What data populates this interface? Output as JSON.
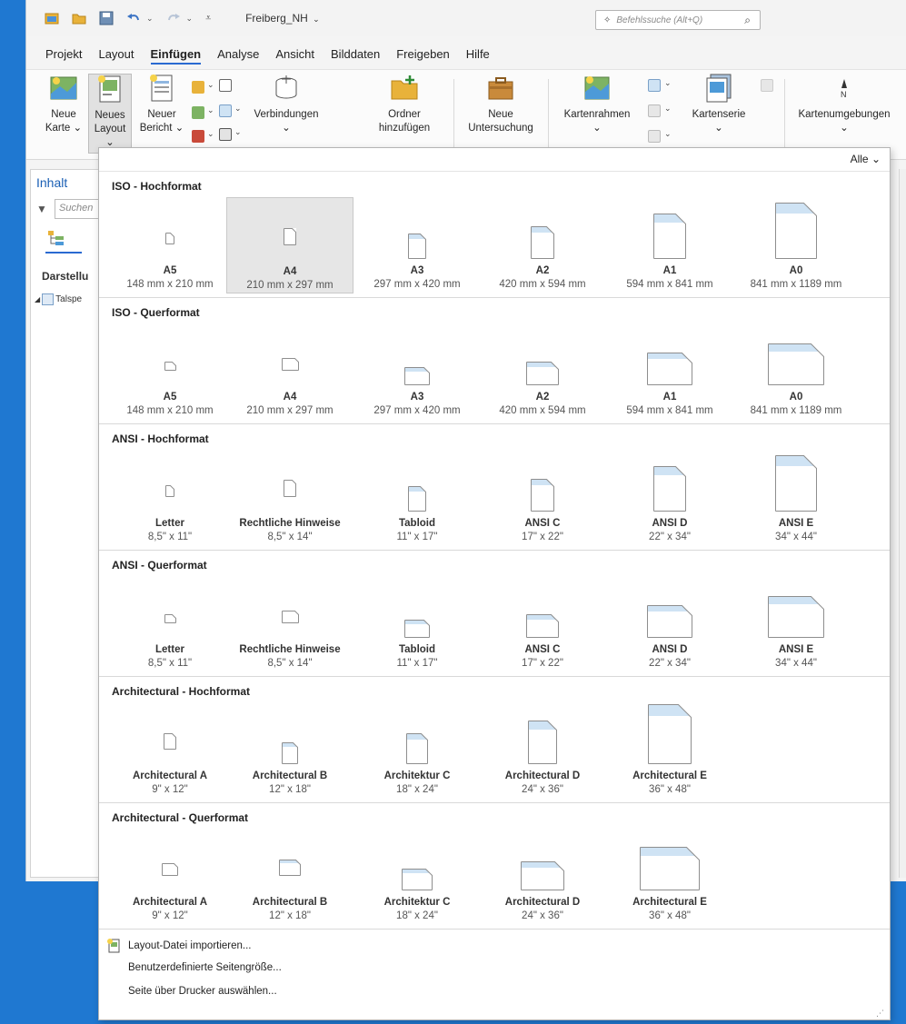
{
  "window": {
    "doc_title": "Freiberg_NH",
    "command_search_placeholder": "Befehlssuche (Alt+Q)"
  },
  "menu": [
    "Projekt",
    "Layout",
    "Einfügen",
    "Analyse",
    "Ansicht",
    "Bilddaten",
    "Freigeben",
    "Hilfe"
  ],
  "menu_active_index": 2,
  "ribbon": {
    "new_map": [
      "Neue",
      "Karte ⌄"
    ],
    "new_layout": [
      "Neues",
      "Layout ⌄"
    ],
    "new_report": [
      "Neuer",
      "Bericht ⌄"
    ],
    "connections": [
      "Verbindungen",
      "⌄"
    ],
    "add_folder": [
      "Ordner",
      "hinzufügen"
    ],
    "new_investigation": [
      "Neue",
      "Untersuchung"
    ],
    "map_frame": [
      "Kartenrahmen",
      "⌄"
    ],
    "map_series": [
      "Kartenserie",
      "⌄"
    ],
    "map_surrounds": [
      "Kartenumgebungen",
      "⌄"
    ]
  },
  "left_pane": {
    "title": "Inhalt",
    "search_placeholder": "Suchen",
    "section_label": "Darstellu",
    "node_label": "Talspe"
  },
  "gallery": {
    "filter_label": "Alle ⌄",
    "sections": [
      {
        "title": "ISO - Hochformat",
        "tiles": [
          {
            "name": "A5",
            "size": "148 mm x 210 mm"
          },
          {
            "name": "A4",
            "size": "210 mm x 297 mm"
          },
          {
            "name": "A3",
            "size": "297 mm x 420 mm"
          },
          {
            "name": "A2",
            "size": "420 mm x 594 mm"
          },
          {
            "name": "A1",
            "size": "594 mm x 841 mm"
          },
          {
            "name": "A0",
            "size": "841 mm x 1189 mm"
          }
        ]
      },
      {
        "title": "ISO - Querformat",
        "tiles": [
          {
            "name": "A5",
            "size": "148 mm x 210 mm"
          },
          {
            "name": "A4",
            "size": "210 mm x 297 mm"
          },
          {
            "name": "A3",
            "size": "297 mm x 420 mm"
          },
          {
            "name": "A2",
            "size": "420 mm x 594 mm"
          },
          {
            "name": "A1",
            "size": "594 mm x 841 mm"
          },
          {
            "name": "A0",
            "size": "841 mm x 1189 mm"
          }
        ]
      },
      {
        "title": "ANSI - Hochformat",
        "tiles": [
          {
            "name": "Letter",
            "size": "8,5\" x 11\""
          },
          {
            "name": "Rechtliche Hinweise",
            "size": "8,5\" x 14\""
          },
          {
            "name": "Tabloid",
            "size": "11\" x 17\""
          },
          {
            "name": "ANSI C",
            "size": "17\" x 22\""
          },
          {
            "name": "ANSI D",
            "size": "22\" x 34\""
          },
          {
            "name": "ANSI E",
            "size": "34\" x 44\""
          }
        ]
      },
      {
        "title": "ANSI - Querformat",
        "tiles": [
          {
            "name": "Letter",
            "size": "8,5\" x 11\""
          },
          {
            "name": "Rechtliche Hinweise",
            "size": "8,5\" x 14\""
          },
          {
            "name": "Tabloid",
            "size": "11\" x 17\""
          },
          {
            "name": "ANSI C",
            "size": "17\" x 22\""
          },
          {
            "name": "ANSI D",
            "size": "22\" x 34\""
          },
          {
            "name": "ANSI E",
            "size": "34\" x 44\""
          }
        ]
      },
      {
        "title": "Architectural - Hochformat",
        "tiles": [
          {
            "name": "Architectural A",
            "size": "9\" x 12\""
          },
          {
            "name": "Architectural B",
            "size": "12\" x 18\""
          },
          {
            "name": "Architektur C",
            "size": "18\" x 24\""
          },
          {
            "name": "Architectural D",
            "size": "24\" x 36\""
          },
          {
            "name": "Architectural E",
            "size": "36\" x 48\""
          }
        ]
      },
      {
        "title": "Architectural - Querformat",
        "tiles": [
          {
            "name": "Architectural A",
            "size": "9\" x 12\""
          },
          {
            "name": "Architectural B",
            "size": "12\" x 18\""
          },
          {
            "name": "Architektur C",
            "size": "18\" x 24\""
          },
          {
            "name": "Architectural D",
            "size": "24\" x 36\""
          },
          {
            "name": "Architectural E",
            "size": "36\" x 48\""
          }
        ]
      }
    ],
    "selected": "ISO - Hochformat / A4",
    "footer": [
      "Layout-Datei importieren...",
      "Benutzerdefinierte Seitengröße...",
      "Seite über Drucker auswählen..."
    ]
  },
  "colors": {
    "desktop": "#1f78d1",
    "accent": "#2a6ad1",
    "page_band": "#cfe3f4",
    "selected_tile": "#e6e6e6"
  }
}
